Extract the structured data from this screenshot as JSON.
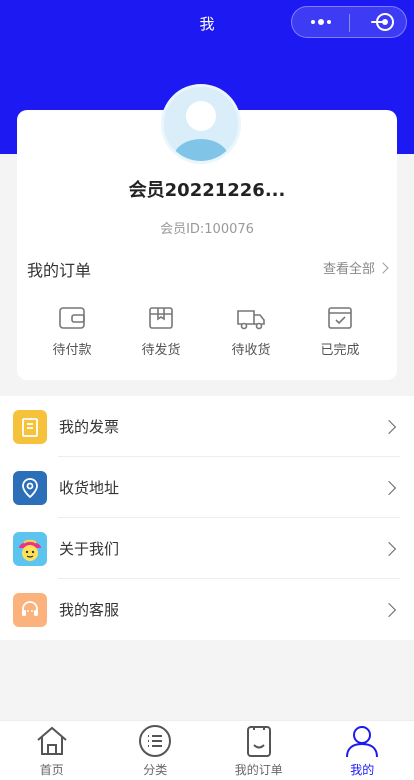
{
  "nav": {
    "title": "我"
  },
  "profile": {
    "name": "会员20221226...",
    "member_id": "会员ID:100076"
  },
  "orders": {
    "title": "我的订单",
    "view_all": "查看全部",
    "items": [
      {
        "label": "待付款",
        "icon": "wallet-icon"
      },
      {
        "label": "待发货",
        "icon": "package-icon"
      },
      {
        "label": "待收货",
        "icon": "truck-icon"
      },
      {
        "label": "已完成",
        "icon": "completed-box-icon"
      }
    ]
  },
  "menu": [
    {
      "label": "我的发票",
      "icon": "invoice-icon",
      "color": "#f7c23b"
    },
    {
      "label": "收货地址",
      "icon": "location-pin-icon",
      "color": "#2a6fb8"
    },
    {
      "label": "关于我们",
      "icon": "mascot-icon",
      "color": "#5cc4ef"
    },
    {
      "label": "我的客服",
      "icon": "customer-service-icon",
      "color": "#fbb27c"
    }
  ],
  "tabbar": [
    {
      "label": "首页",
      "icon": "home-icon",
      "active": false
    },
    {
      "label": "分类",
      "icon": "category-icon",
      "active": false
    },
    {
      "label": "我的订单",
      "icon": "orders-icon",
      "active": false
    },
    {
      "label": "我的",
      "icon": "user-icon",
      "active": true
    }
  ],
  "colors": {
    "primary": "#1d19f3",
    "background": "#f4f4f4"
  }
}
